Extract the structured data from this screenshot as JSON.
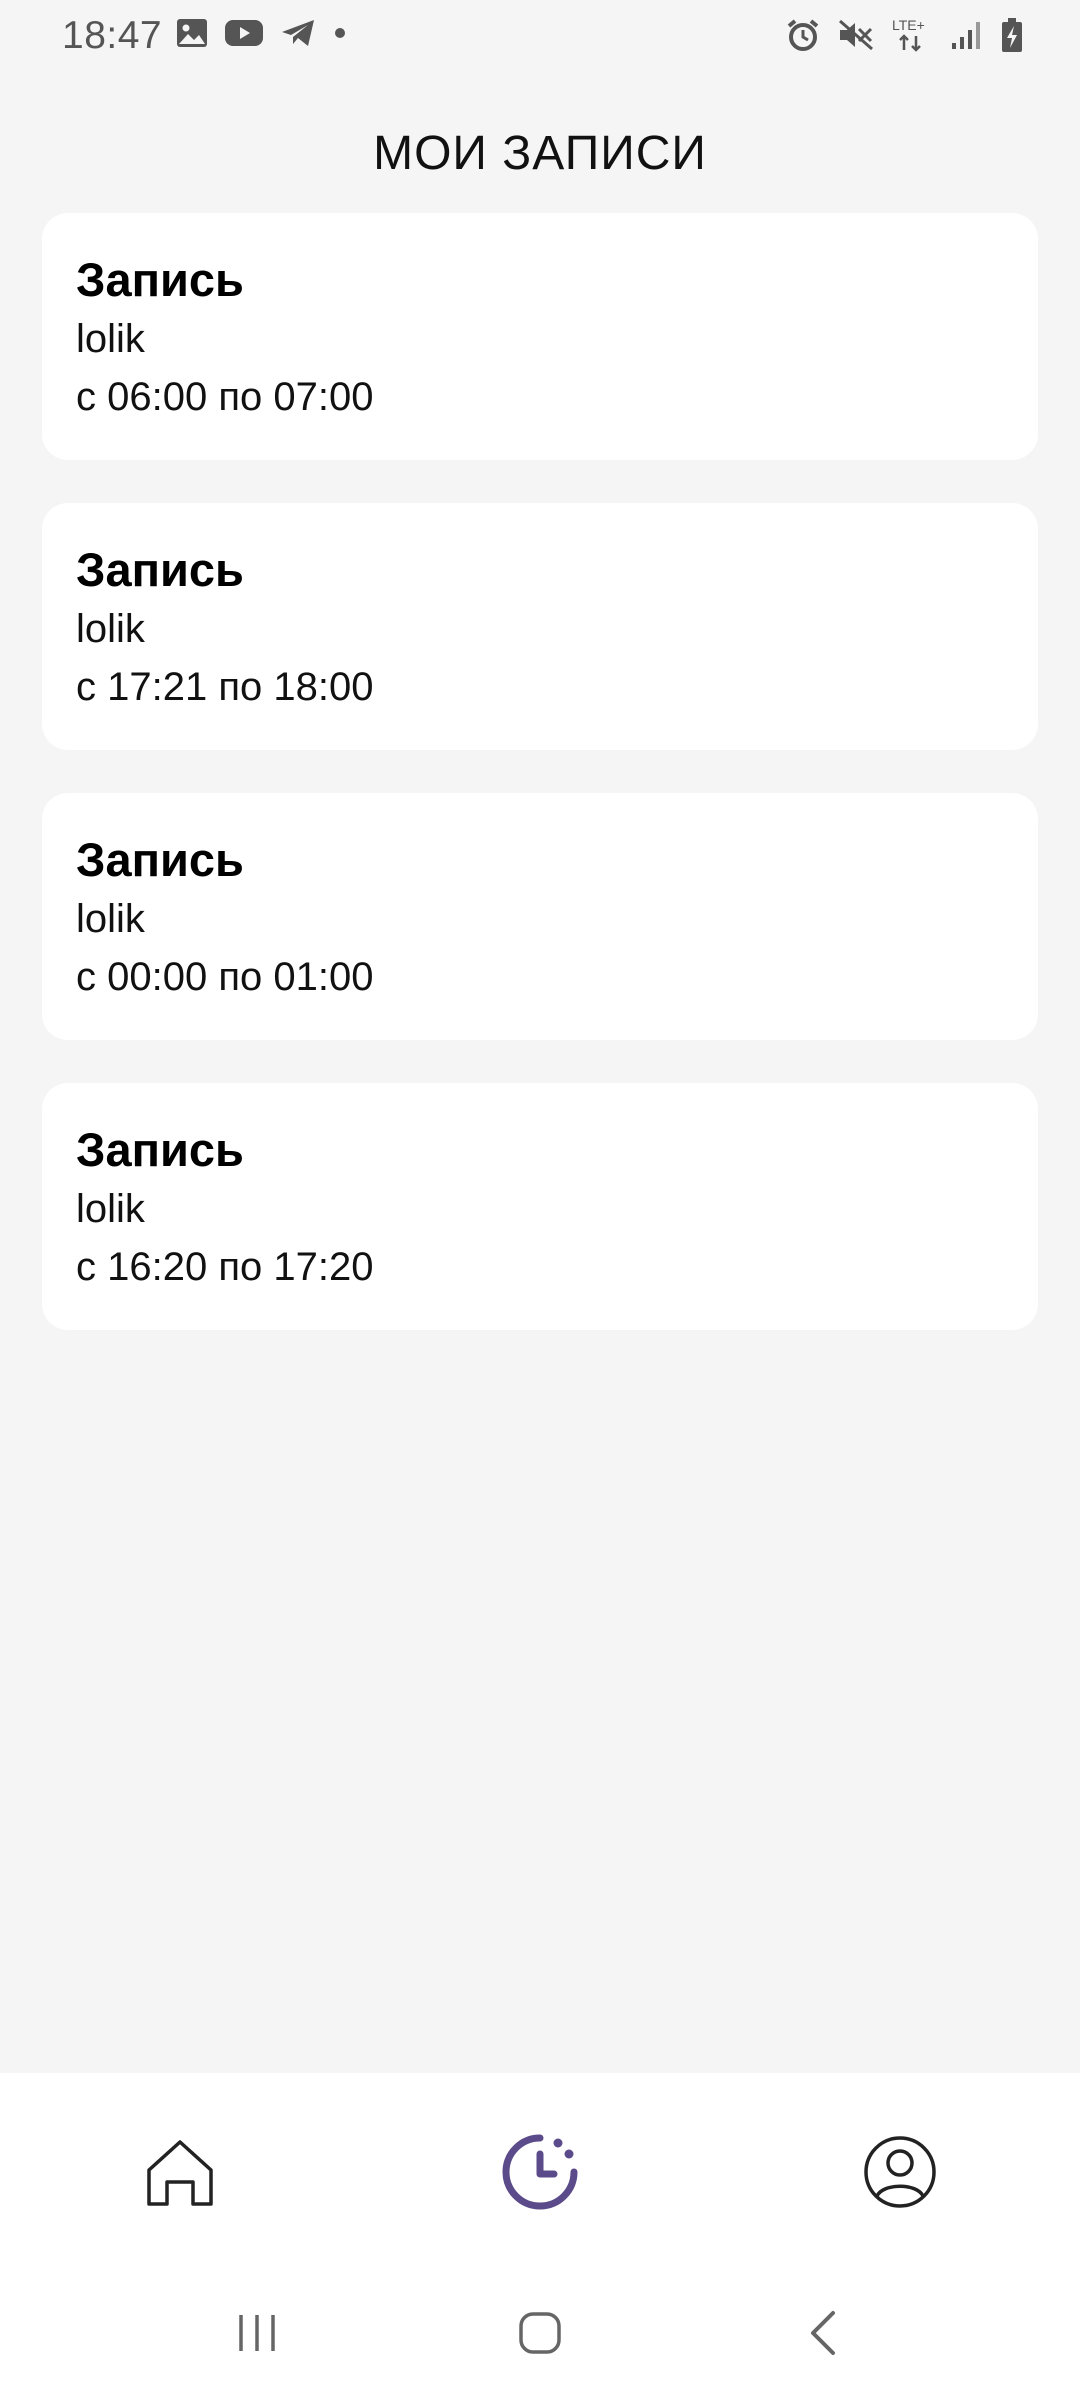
{
  "status_bar": {
    "time": "18:47",
    "left_icons": [
      "gallery-icon",
      "youtube-icon",
      "telegram-icon",
      "dot-icon"
    ],
    "right_icons": [
      "alarm-icon",
      "mute-icon",
      "lte-icon",
      "signal-icon",
      "battery-icon"
    ],
    "network_label": "LTE+"
  },
  "header": {
    "title": "МОИ ЗАПИСИ"
  },
  "records": [
    {
      "title": "Запись",
      "name": "lolik",
      "time": "с 06:00 по 07:00"
    },
    {
      "title": "Запись",
      "name": "lolik",
      "time": "с 17:21 по 18:00"
    },
    {
      "title": "Запись",
      "name": "lolik",
      "time": "с 00:00 по 01:00"
    },
    {
      "title": "Запись",
      "name": "lolik",
      "time": "с 16:20 по 17:20"
    }
  ],
  "tab_bar": {
    "tabs": [
      {
        "icon": "home-icon",
        "active": false
      },
      {
        "icon": "clock-icon",
        "active": true
      },
      {
        "icon": "profile-icon",
        "active": false
      }
    ],
    "active_color": "#5b4b8a",
    "inactive_color": "#222222"
  },
  "nav_bar": {
    "buttons": [
      "recents-icon",
      "home-circle-icon",
      "back-icon"
    ]
  }
}
